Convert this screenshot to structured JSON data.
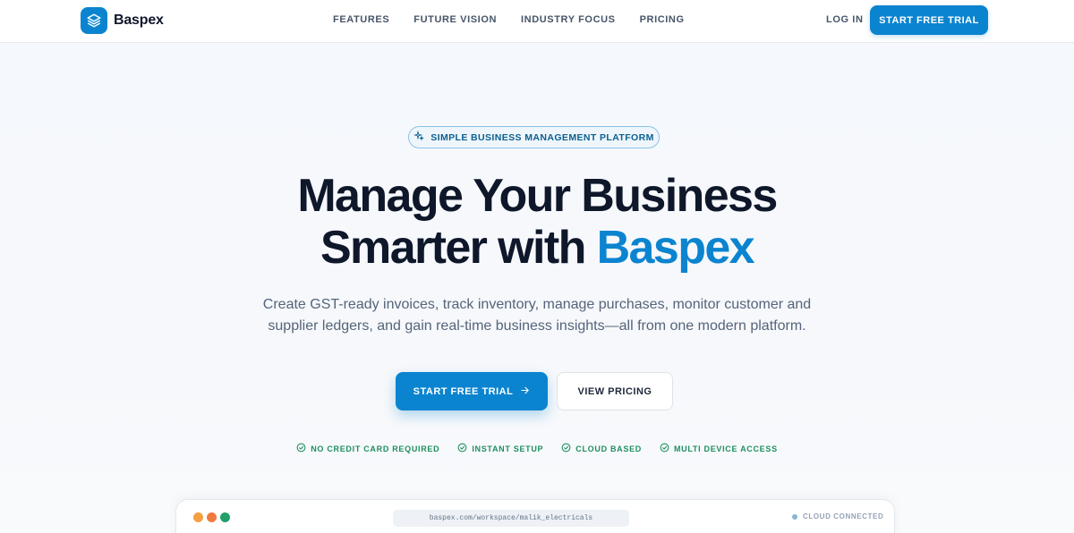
{
  "brand": {
    "name": "Baspex",
    "accent": "#0b84d0"
  },
  "nav": {
    "links": [
      "FEATURES",
      "FUTURE VISION",
      "INDUSTRY FOCUS",
      "PRICING"
    ],
    "login": "LOG IN",
    "cta": "START FREE TRIAL"
  },
  "hero": {
    "badge": "SIMPLE BUSINESS MANAGEMENT PLATFORM",
    "badge_icon": "sparkle-icon",
    "headline_line1": "Manage Your Business",
    "headline_line2_prefix": "Smarter with",
    "headline_line2_accent": "Baspex",
    "subheadline": "Create GST-ready invoices, track inventory, manage purchases, monitor customer and supplier ledgers, and gain real-time business insights—all from one modern platform.",
    "primary_cta": "START FREE TRIAL",
    "primary_cta_icon": "arrow-right-icon",
    "secondary_cta": "VIEW PRICING",
    "features": [
      "NO CREDIT CARD REQUIRED",
      "INSTANT SETUP",
      "CLOUD BASED",
      "MULTI DEVICE ACCESS"
    ],
    "feature_icon": "check-circle-icon",
    "feature_color": "#1f8f5f"
  },
  "browser": {
    "dot_colors": [
      "#f59e42",
      "#f07b3f",
      "#22a06b"
    ],
    "url": "baspex.com/workspace/malik_electricals",
    "status": "CLOUD CONNECTED"
  }
}
